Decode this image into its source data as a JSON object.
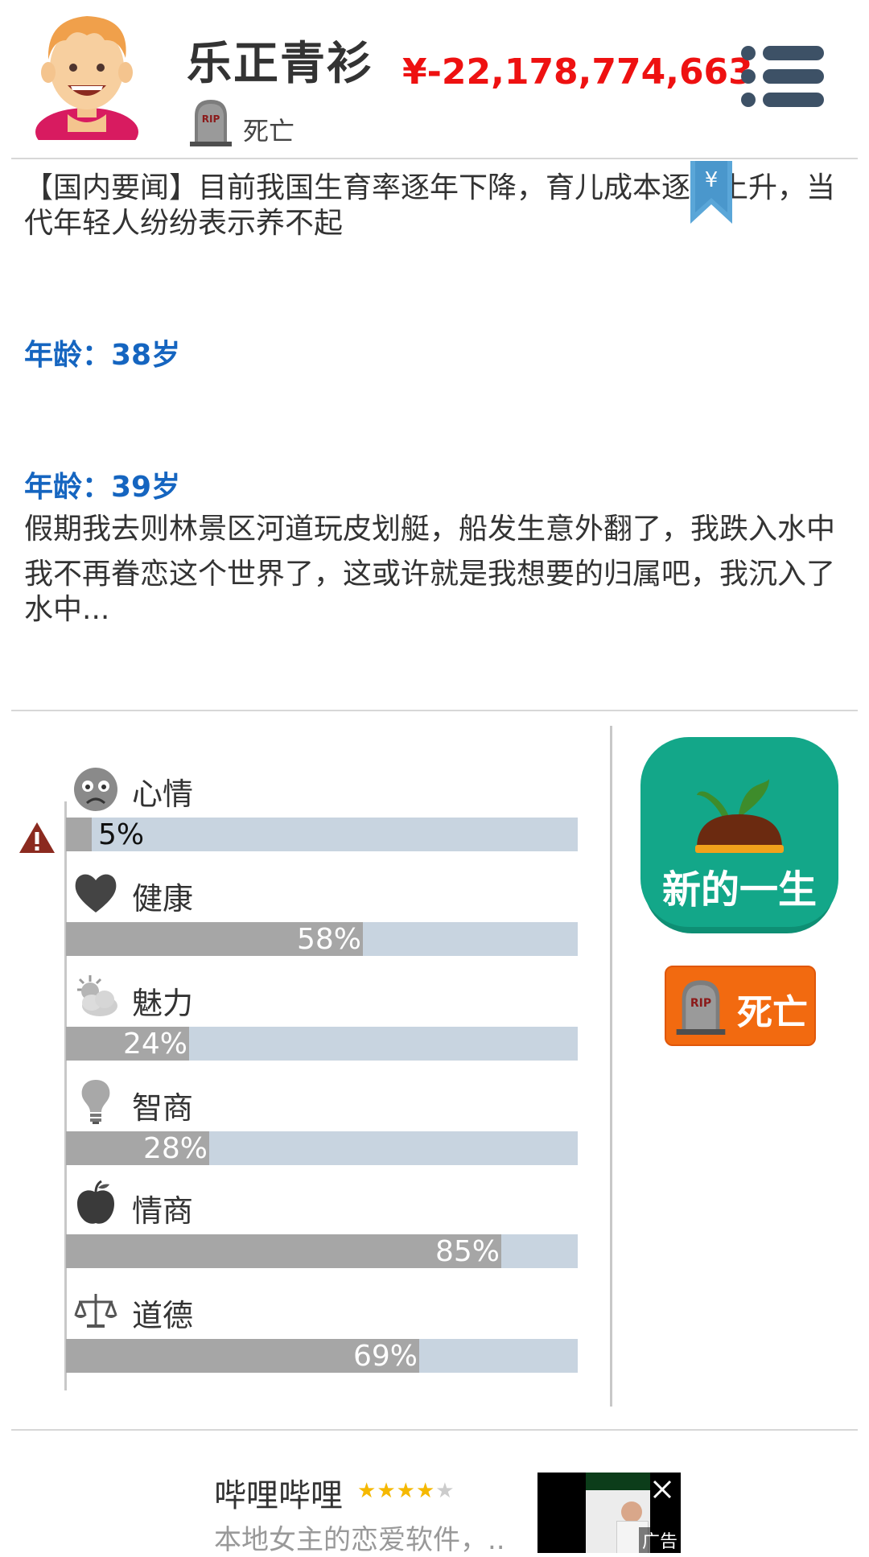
{
  "header": {
    "name": "乐正青衫",
    "status": "死亡",
    "money": "¥-22,178,774,663"
  },
  "log": {
    "news": "【国内要闻】目前我国生育率逐年下降，育儿成本逐年上升，当代年轻人纷纷表示养不起",
    "entries": [
      {
        "age": "年龄：38岁",
        "lines": []
      },
      {
        "age": "年龄：39岁",
        "lines": [
          "假期我去则林景区河道玩皮划艇，船发生意外翻了，我跌入水中",
          "我不再眷恋这个世界了，这或许就是我想要的归属吧，我沉入了水中..."
        ]
      }
    ]
  },
  "stats": [
    {
      "label": "心情",
      "value": 5,
      "text": "5%",
      "icon": "sad-face-icon",
      "warning": true
    },
    {
      "label": "健康",
      "value": 58,
      "text": "58%",
      "icon": "heart-icon"
    },
    {
      "label": "魅力",
      "value": 24,
      "text": "24%",
      "icon": "sun-cloud-icon"
    },
    {
      "label": "智商",
      "value": 28,
      "text": "28%",
      "icon": "lightbulb-icon"
    },
    {
      "label": "情商",
      "value": 85,
      "text": "85%",
      "icon": "apple-icon"
    },
    {
      "label": "道德",
      "value": 69,
      "text": "69%",
      "icon": "scale-icon"
    }
  ],
  "actions": {
    "new_life": "新的一生",
    "death": "死亡"
  },
  "ad": {
    "title": "哔哩哔哩",
    "rating": 4,
    "description": "本地女主的恋爱软件，..",
    "badge": "广告"
  },
  "colors": {
    "money": "#ee1111",
    "age": "#1565c0",
    "bar_fill": "#a6a6a6",
    "bar_track": "#c8d4e0",
    "new_life_bg": "#13a789",
    "death_bg": "#f26a10"
  }
}
